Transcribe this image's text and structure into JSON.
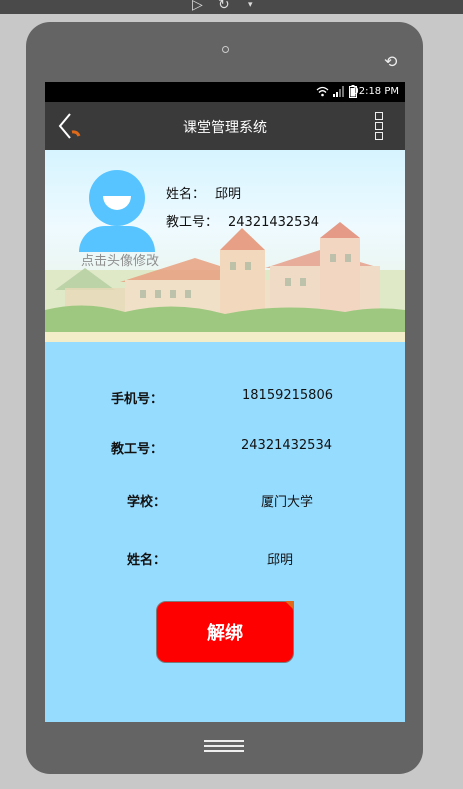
{
  "window": {
    "play_icon": "play-icon",
    "refresh_icon": "refresh-icon",
    "dropdown_icon": "caret-down-icon"
  },
  "device": {
    "rotate_icon": "rotate-icon",
    "home_icon": "home-lines-icon"
  },
  "statusbar": {
    "time": "02:18 PM",
    "icons": [
      "wifi-icon",
      "signal-icon",
      "battery-icon"
    ]
  },
  "appbar": {
    "title": "课堂管理系统",
    "back_icon": "back-chevron-icon",
    "menu_icon": "more-vertical-icon"
  },
  "profile": {
    "avatar_label": "点击头像修改",
    "name_label": "姓名：",
    "name_value": "邱明",
    "id_label": "教工号：",
    "id_value": "24321432534"
  },
  "details": [
    {
      "label": "手机号：",
      "value": "18159215806"
    },
    {
      "label": "教工号：",
      "value": "24321432534"
    },
    {
      "label": "学校：",
      "value": "厦门大学"
    },
    {
      "label": "姓名：",
      "value": "邱明"
    }
  ],
  "actions": {
    "unbind_label": "解绑"
  },
  "colors": {
    "content_bg": "#96dcff",
    "avatar": "#58c4ff",
    "unbind_button": "#ff0000",
    "appbar": "#3a3a3a"
  }
}
